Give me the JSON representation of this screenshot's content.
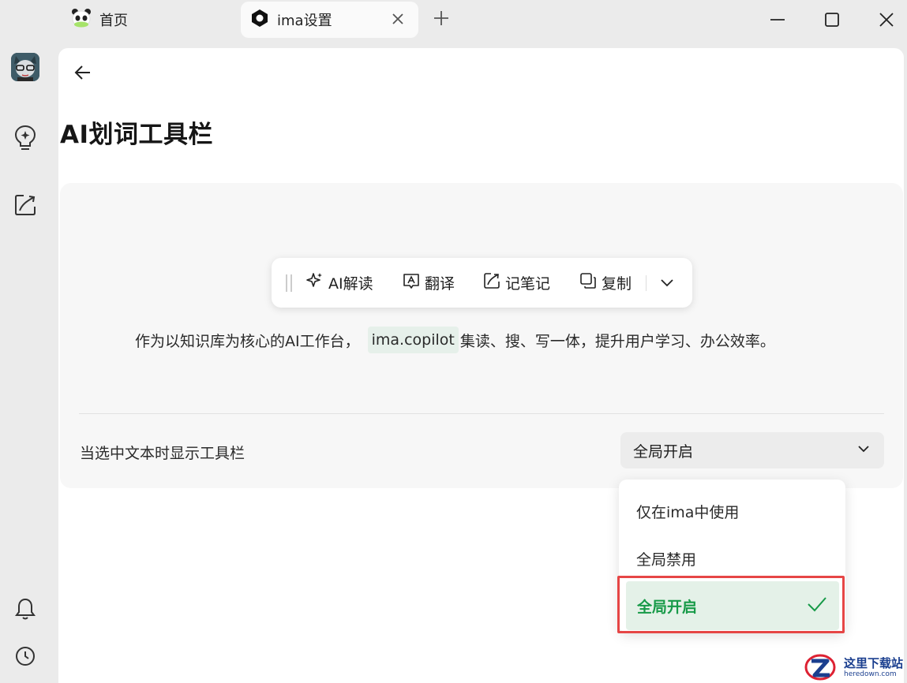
{
  "titlebar": {
    "tabs": [
      {
        "label": "首页",
        "icon": "panda-icon"
      },
      {
        "label": "ima设置",
        "icon": "ima-logo-icon"
      }
    ]
  },
  "page": {
    "title": "AI划词工具栏"
  },
  "preview_toolbar": {
    "items": [
      {
        "label": "AI解读",
        "icon": "sparkle-icon"
      },
      {
        "label": "翻译",
        "icon": "translate-icon"
      },
      {
        "label": "记笔记",
        "icon": "note-icon"
      },
      {
        "label": "复制",
        "icon": "copy-icon"
      }
    ]
  },
  "description": {
    "before": "作为以知识库为核心的AI工作台，",
    "highlight": "ima.copilot",
    "after": "集读、搜、写一体，提升用户学习、办公效率。"
  },
  "setting": {
    "label": "当选中文本时显示工具栏",
    "selected": "全局开启",
    "options": [
      "仅在ima中使用",
      "全局禁用",
      "全局开启"
    ]
  },
  "colors": {
    "accent": "#179a48",
    "selected_bg": "#e4f1e8",
    "annotation": "#e64646"
  },
  "watermark_logo": {
    "text": "这里下载站",
    "url": "heredown.com"
  }
}
